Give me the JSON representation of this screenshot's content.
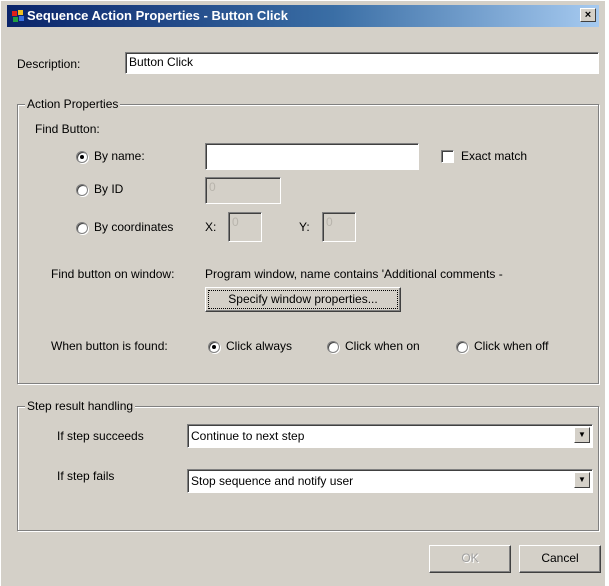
{
  "window": {
    "title": "Sequence Action Properties - Button Click",
    "close_glyph": "×"
  },
  "description": {
    "label": "Description:",
    "value": "Button Click"
  },
  "action_properties": {
    "group_label": "Action Properties",
    "find_button_label": "Find Button:",
    "by_name_label": "By name:",
    "by_name_value": "",
    "by_name_selected": true,
    "exact_match_label": "Exact match",
    "exact_match_checked": false,
    "by_id_label": "By ID",
    "by_id_value": "0",
    "by_coordinates_label": "By coordinates",
    "x_label": "X:",
    "x_value": "0",
    "y_label": "Y:",
    "y_value": "0",
    "find_on_window_label": "Find button on window:",
    "find_on_window_value": "Program window, name contains 'Additional comments -",
    "specify_window_button": "Specify window properties...",
    "when_found_label": "When button is found:",
    "click_options": [
      "Click always",
      "Click when on",
      "Click when off"
    ],
    "click_selected": 0
  },
  "step_result": {
    "group_label": "Step result handling",
    "succeeds_label": "If step succeeds",
    "succeeds_value": "Continue to next step",
    "fails_label": "If step fails",
    "fails_value": "Stop sequence and notify user"
  },
  "buttons": {
    "ok": "OK",
    "cancel": "Cancel"
  },
  "colors": {
    "face": "#d4d0c8",
    "title_start": "#0a246a",
    "title_end": "#a6caf0"
  },
  "icons": {
    "app": "program-icon",
    "close": "close-icon",
    "dropdown": "dropdown-arrow-icon"
  }
}
